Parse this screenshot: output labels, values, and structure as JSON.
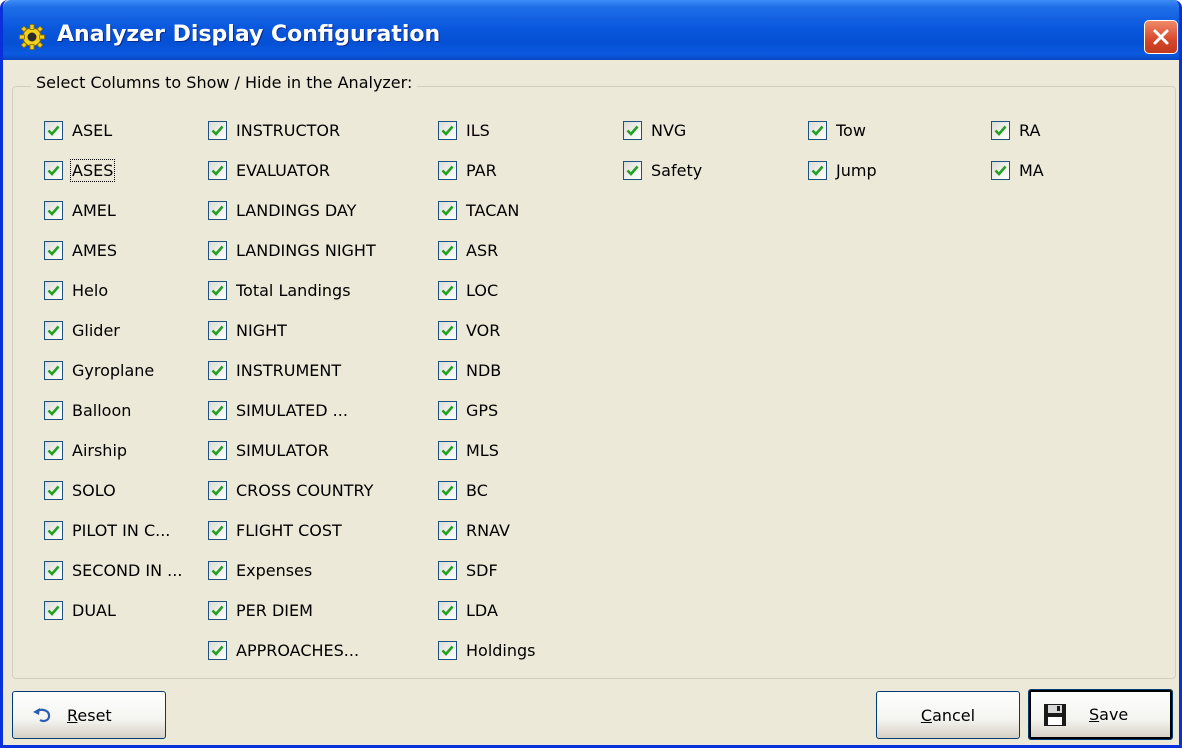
{
  "window": {
    "title": "Analyzer Display Configuration",
    "app_icon": "gear-sun-icon",
    "close_icon": "close-icon"
  },
  "group": {
    "legend": "Select Columns to Show / Hide in the Analyzer:"
  },
  "columns": [
    [
      {
        "label": "ASEL",
        "checked": true
      },
      {
        "label": "ASES",
        "checked": true,
        "focused": true
      },
      {
        "label": "AMEL",
        "checked": true
      },
      {
        "label": "AMES",
        "checked": true
      },
      {
        "label": "Helo",
        "checked": true
      },
      {
        "label": "Glider",
        "checked": true
      },
      {
        "label": "Gyroplane",
        "checked": true
      },
      {
        "label": "Balloon",
        "checked": true
      },
      {
        "label": "Airship",
        "checked": true
      },
      {
        "label": "SOLO",
        "checked": true
      },
      {
        "label": "PILOT IN C...",
        "checked": true
      },
      {
        "label": "SECOND IN ...",
        "checked": true
      },
      {
        "label": "DUAL",
        "checked": true
      }
    ],
    [
      {
        "label": "INSTRUCTOR",
        "checked": true
      },
      {
        "label": "EVALUATOR",
        "checked": true
      },
      {
        "label": "LANDINGS DAY",
        "checked": true
      },
      {
        "label": "LANDINGS NIGHT",
        "checked": true
      },
      {
        "label": "Total Landings",
        "checked": true
      },
      {
        "label": "NIGHT",
        "checked": true
      },
      {
        "label": "INSTRUMENT",
        "checked": true
      },
      {
        "label": "SIMULATED ...",
        "checked": true
      },
      {
        "label": "SIMULATOR",
        "checked": true
      },
      {
        "label": "CROSS COUNTRY",
        "checked": true
      },
      {
        "label": "FLIGHT COST",
        "checked": true
      },
      {
        "label": "Expenses",
        "checked": true
      },
      {
        "label": "PER DIEM",
        "checked": true
      },
      {
        "label": "APPROACHES...",
        "checked": true
      }
    ],
    [
      {
        "label": "ILS",
        "checked": true
      },
      {
        "label": "PAR",
        "checked": true
      },
      {
        "label": "TACAN",
        "checked": true
      },
      {
        "label": "ASR",
        "checked": true
      },
      {
        "label": "LOC",
        "checked": true
      },
      {
        "label": "VOR",
        "checked": true
      },
      {
        "label": "NDB",
        "checked": true
      },
      {
        "label": "GPS",
        "checked": true
      },
      {
        "label": "MLS",
        "checked": true
      },
      {
        "label": "BC",
        "checked": true
      },
      {
        "label": "RNAV",
        "checked": true
      },
      {
        "label": "SDF",
        "checked": true
      },
      {
        "label": "LDA",
        "checked": true
      },
      {
        "label": "Holdings",
        "checked": true
      }
    ],
    [
      {
        "label": "NVG",
        "checked": true
      },
      {
        "label": "Safety",
        "checked": true
      }
    ],
    [
      {
        "label": "Tow",
        "checked": true
      },
      {
        "label": "Jump",
        "checked": true
      }
    ],
    [
      {
        "label": "RA",
        "checked": true
      },
      {
        "label": "MA",
        "checked": true
      }
    ]
  ],
  "buttons": {
    "reset": {
      "label": "Reset",
      "accel": "R",
      "rest": "eset",
      "icon": "undo-arrow-icon"
    },
    "cancel": {
      "label": "Cancel",
      "accel": "C",
      "rest": "ancel"
    },
    "save": {
      "label": "Save",
      "accel": "S",
      "rest": "ave",
      "icon": "floppy-disk-icon"
    }
  },
  "colors": {
    "titlebar": "#0a58de",
    "dialog_bg": "#ece9d8",
    "close_button": "#d6472a",
    "checkmark": "#21a121"
  }
}
